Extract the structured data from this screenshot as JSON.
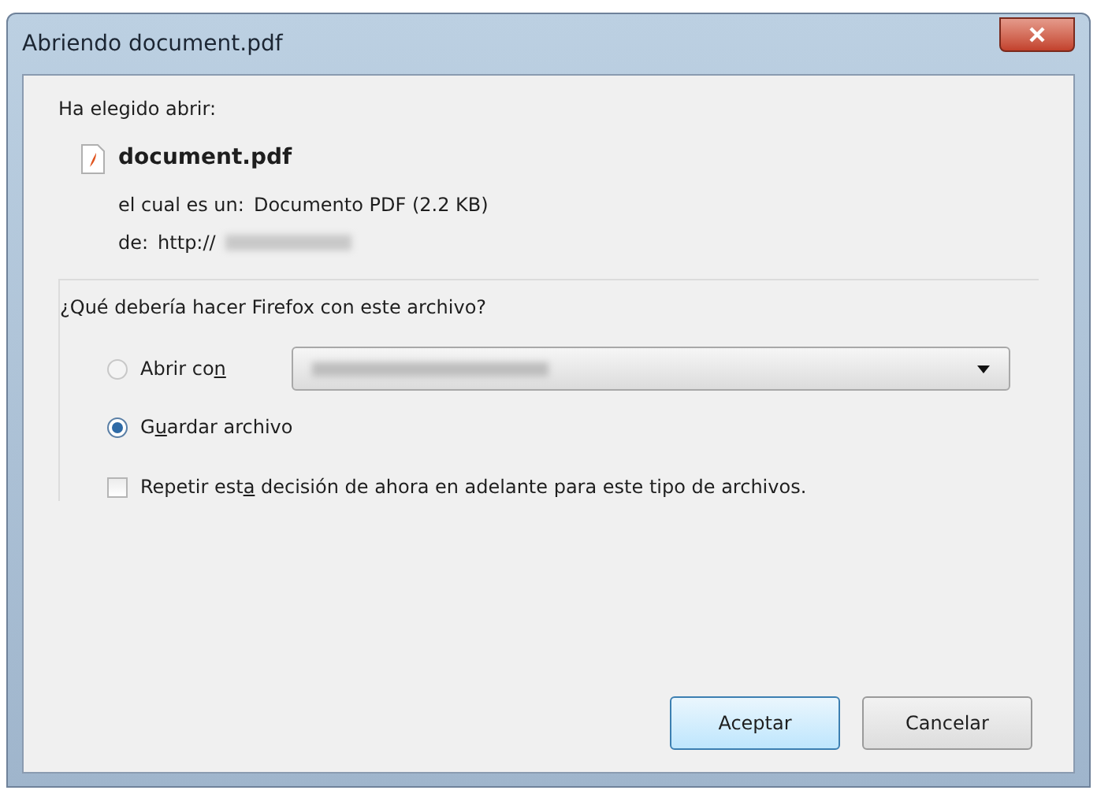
{
  "window": {
    "title": "Abriendo document.pdf"
  },
  "intro": "Ha elegido abrir:",
  "file": {
    "name": "document.pdf",
    "type_label": "el cual es un:",
    "type_value": "Documento PDF (2.2 KB)",
    "from_label": "de:",
    "from_value": "http://"
  },
  "question": "¿Qué debería hacer Firefox con este archivo?",
  "options": [
    {
      "kind": "radio",
      "label_parts": [
        "Abrir co",
        "n"
      ],
      "selected": false,
      "has_dropdown": true
    },
    {
      "kind": "radio",
      "label_parts": [
        "G",
        "u",
        "ardar archivo"
      ],
      "selected": true,
      "has_dropdown": false
    }
  ],
  "remember": {
    "label_parts": [
      "Repetir est",
      "a",
      " decisión de ahora en adelante para este tipo de archivos."
    ],
    "checked": false
  },
  "buttons": [
    {
      "label": "Aceptar",
      "default": true
    },
    {
      "label": "Cancelar",
      "default": false
    }
  ]
}
